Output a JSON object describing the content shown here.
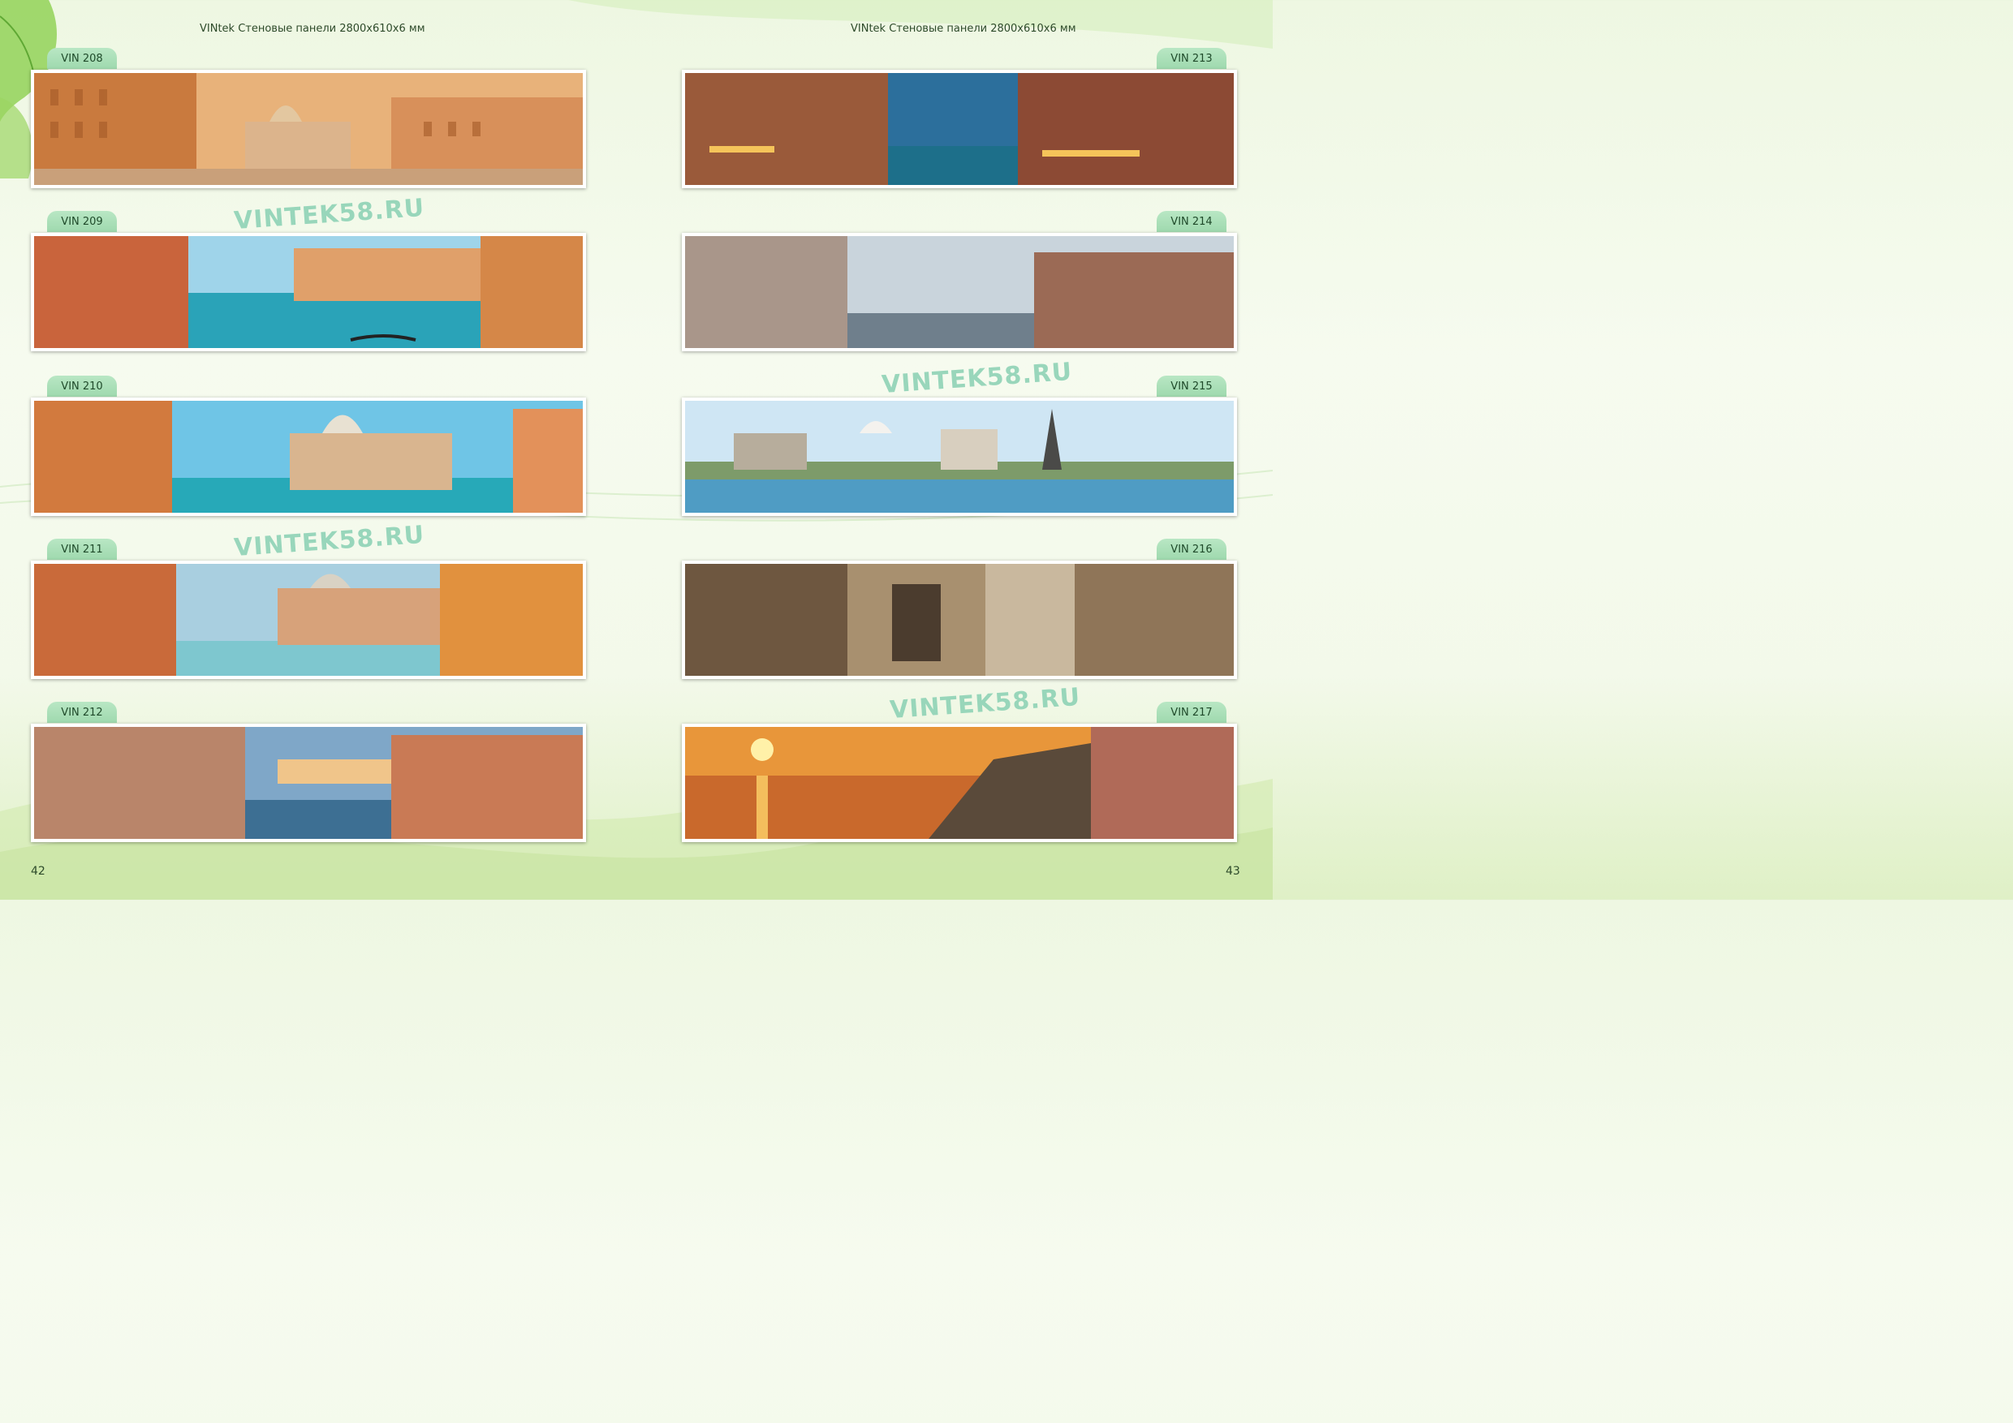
{
  "pages": [
    {
      "header": "VINtek Стеновые панели 2800x610x6 мм",
      "page_number": "42",
      "panels": [
        {
          "code": "VIN 208",
          "image": "venice-grand-canal-vintage-sepia"
        },
        {
          "code": "VIN 209",
          "image": "venice-grand-canal-gondola-day"
        },
        {
          "code": "VIN 210",
          "image": "venice-santa-maria-della-salute-day"
        },
        {
          "code": "VIN 211",
          "image": "venice-grand-canal-cloudy-sky"
        },
        {
          "code": "VIN 212",
          "image": "venice-grand-canal-dusk"
        }
      ]
    },
    {
      "header": "VINtek Стеновые панели 2800x610x6 мм",
      "page_number": "43",
      "panels": [
        {
          "code": "VIN 213",
          "image": "venice-grand-canal-night-lights"
        },
        {
          "code": "VIN 214",
          "image": "venice-grand-canal-evening"
        },
        {
          "code": "VIN 215",
          "image": "paris-landmarks-collage-river"
        },
        {
          "code": "VIN 216",
          "image": "venice-gondolas-lantern-sepia-collage"
        },
        {
          "code": "VIN 217",
          "image": "coastal-village-sunset-sea"
        }
      ]
    }
  ],
  "watermark": "VINTEK58.RU",
  "colors": {
    "tab": "#a8ddb6",
    "watermark": "#8fd3b6",
    "background": "#f3f9ea"
  }
}
